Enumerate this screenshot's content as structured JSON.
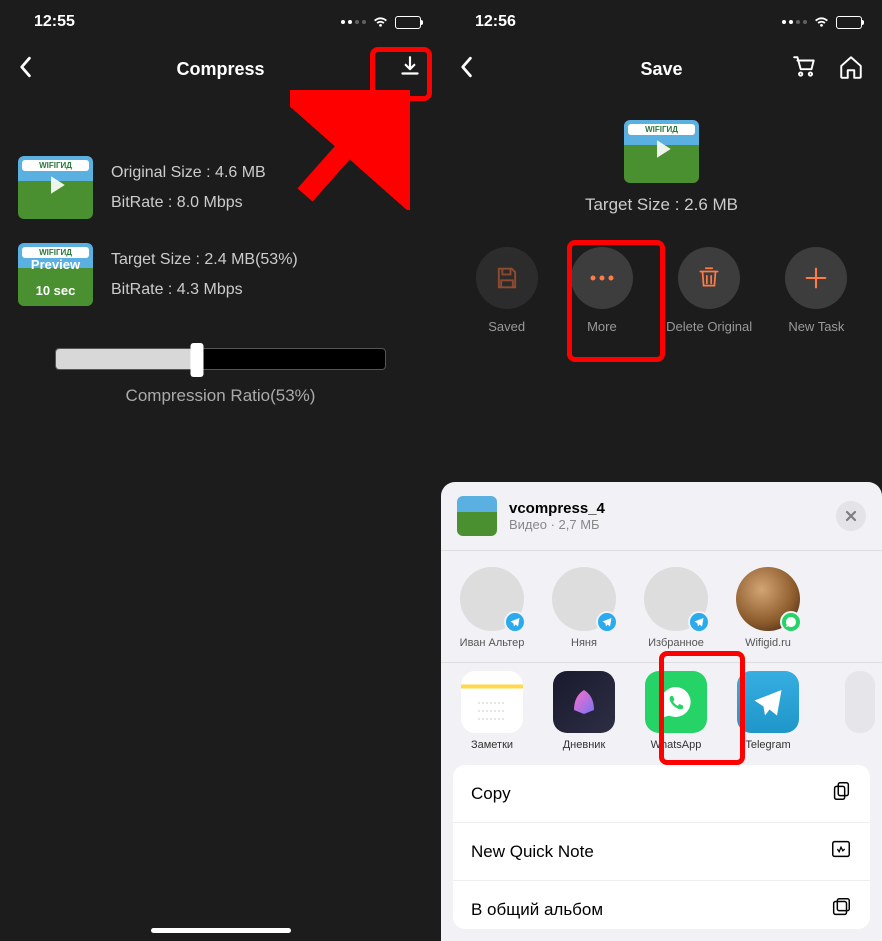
{
  "left": {
    "status_time": "12:55",
    "nav_title": "Compress",
    "thumb_brand": "WIFIГИД",
    "original_size": "Original Size : 4.6 MB",
    "original_bitrate": "BitRate : 8.0 Mbps",
    "preview_label": "Preview",
    "preview_time": "10 sec",
    "target_size": "Target Size : 2.4 MB(53%)",
    "target_bitrate": "BitRate : 4.3 Mbps",
    "slider_label": "Compression Ratio(53%)"
  },
  "right": {
    "status_time": "12:56",
    "nav_title": "Save",
    "thumb_brand": "WIFIГИД",
    "target_size": "Target Size : 2.6 MB",
    "actions": {
      "saved": "Saved",
      "more": "More",
      "delete": "Delete Original",
      "new_task": "New Task"
    },
    "share": {
      "file_name": "vcompress_4",
      "file_meta": "Видео · 2,7 МБ",
      "contacts": [
        {
          "name": "Иван Альтер",
          "badge": "tg"
        },
        {
          "name": "Няня",
          "badge": "tg"
        },
        {
          "name": "Избранное",
          "badge": "tg"
        },
        {
          "name": "Wifigid.ru",
          "badge": "wa",
          "photo": true
        }
      ],
      "apps": [
        {
          "name": "Заметки"
        },
        {
          "name": "Дневник"
        },
        {
          "name": "WhatsApp"
        },
        {
          "name": "Telegram"
        }
      ],
      "list": {
        "copy": "Copy",
        "quick_note": "New Quick Note",
        "shared_album": "В общий альбом"
      }
    }
  }
}
